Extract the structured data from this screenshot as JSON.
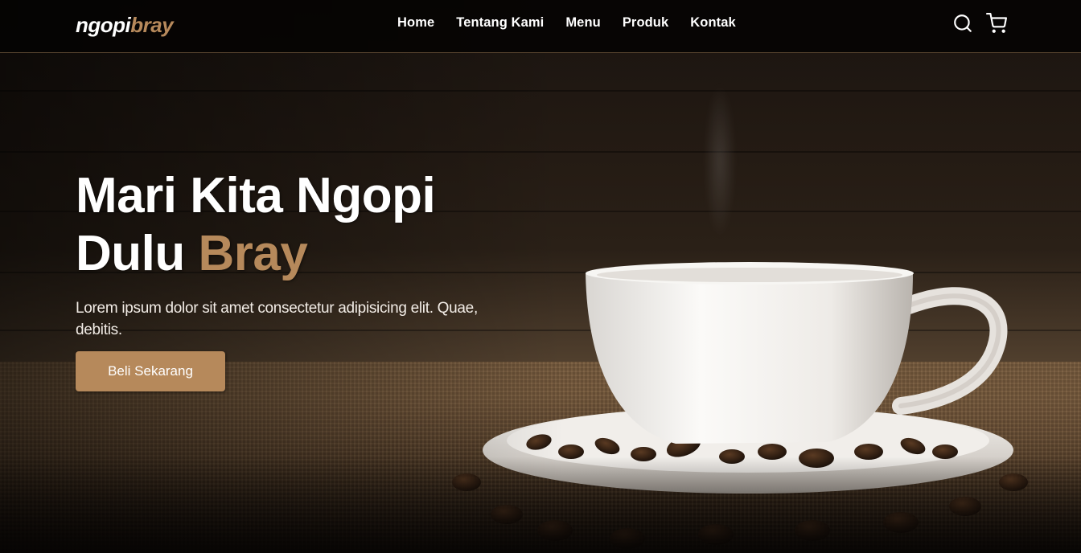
{
  "brand": {
    "name_main": "ngopi",
    "name_accent": "bray",
    "accent_color": "#b6895b"
  },
  "nav": {
    "links": [
      "Home",
      "Tentang Kami",
      "Menu",
      "Produk",
      "Kontak"
    ],
    "icons": [
      "search-icon",
      "shopping-cart-icon"
    ]
  },
  "hero": {
    "title_line1": "Mari Kita Ngopi",
    "title_line2_plain": "Dulu",
    "title_line2_accent": "Bray",
    "description": "Lorem ipsum dolor sit amet consectetur adipisicing elit. Quae, debitis.",
    "cta_label": "Beli Sekarang"
  }
}
